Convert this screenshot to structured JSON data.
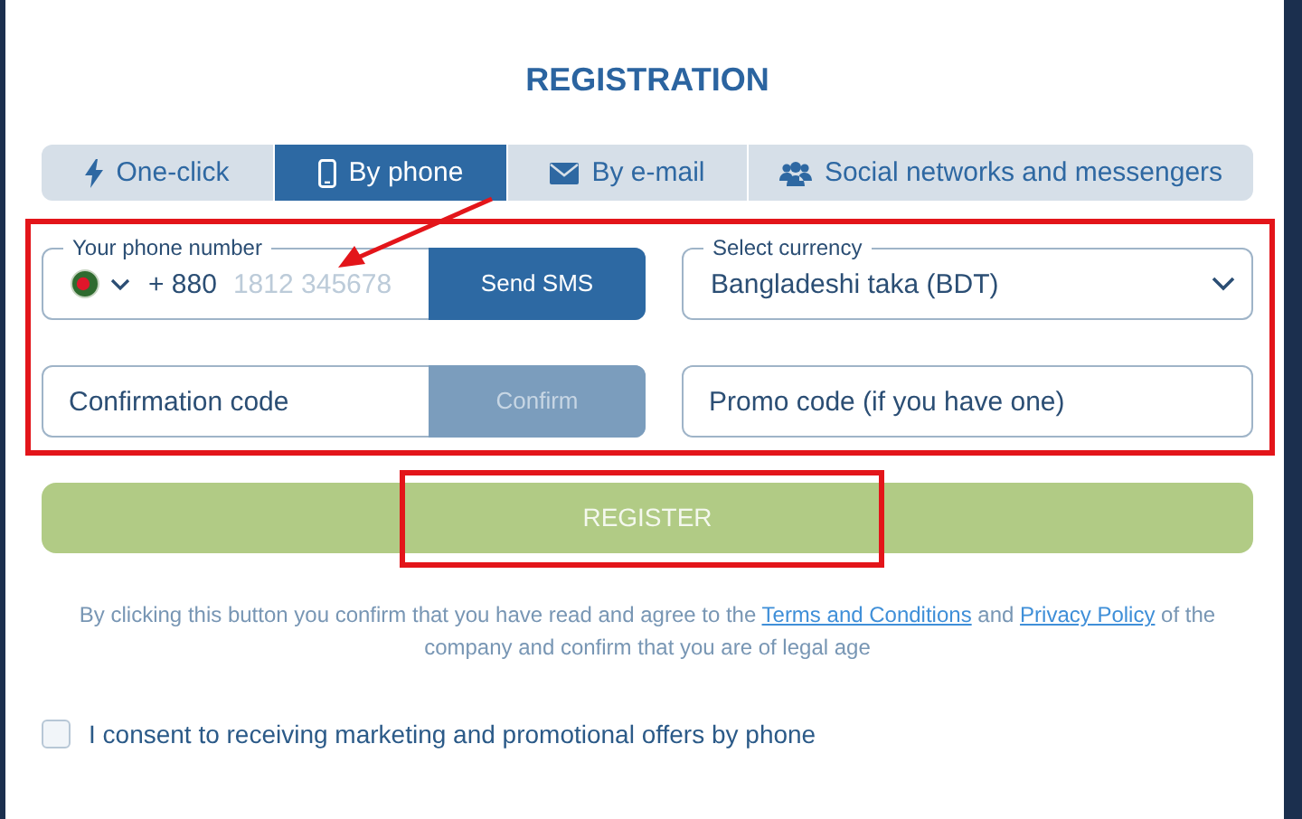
{
  "title": "REGISTRATION",
  "tabs": [
    {
      "label": "One-click",
      "kind": "bolt",
      "selected": false
    },
    {
      "label": "By phone",
      "kind": "phone",
      "selected": true
    },
    {
      "label": "By e-mail",
      "kind": "mail",
      "selected": false
    },
    {
      "label": "Social networks and messengers",
      "kind": "people",
      "selected": false
    }
  ],
  "phone": {
    "label": "Your phone number",
    "code": "+ 880",
    "placeholder": "1812 345678",
    "button": "Send SMS"
  },
  "currency": {
    "label": "Select currency",
    "value": "Bangladeshi taka (BDT)"
  },
  "confirmation": {
    "placeholder": "Confirmation code",
    "button": "Confirm",
    "disabled": true
  },
  "promo": {
    "placeholder": "Promo code (if you have one)"
  },
  "register": {
    "label": "REGISTER",
    "disabled": true
  },
  "legal": [
    {
      "kind": "text",
      "text": "By clicking this button you confirm that you have read and agree to the "
    },
    {
      "kind": "link",
      "text": "Terms and Conditions"
    },
    {
      "kind": "text",
      "text": " and "
    },
    {
      "kind": "link",
      "text": "Privacy Policy"
    },
    {
      "kind": "text",
      "text": " of the company and confirm that you are of legal age"
    }
  ],
  "consent": {
    "label": "I consent to receiving marketing and promotional offers by phone",
    "checked": false
  },
  "annotations": {
    "frame_fields": true,
    "frame_register": true,
    "arrow": true
  }
}
